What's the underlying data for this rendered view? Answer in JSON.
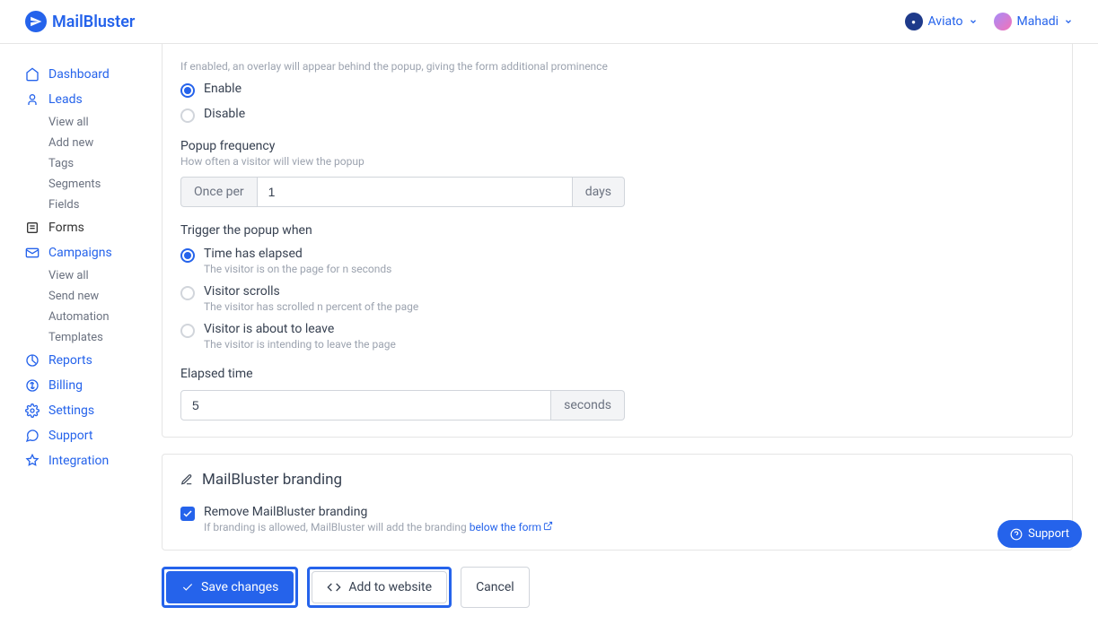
{
  "header": {
    "brand": "MailBluster",
    "workspace": "Aviato",
    "user": "Mahadi"
  },
  "sidebar": {
    "dashboard": "Dashboard",
    "leads": "Leads",
    "leads_items": [
      "View all",
      "Add new",
      "Tags",
      "Segments",
      "Fields"
    ],
    "forms": "Forms",
    "campaigns": "Campaigns",
    "campaigns_items": [
      "View all",
      "Send new",
      "Automation",
      "Templates"
    ],
    "reports": "Reports",
    "billing": "Billing",
    "settings": "Settings",
    "support": "Support",
    "integration": "Integration"
  },
  "overlay": {
    "desc": "If enabled, an overlay will appear behind the popup, giving the form additional prominence",
    "enable": "Enable",
    "disable": "Disable"
  },
  "frequency": {
    "label": "Popup frequency",
    "desc": "How often a visitor will view the popup",
    "prefix": "Once per",
    "value": "1",
    "suffix": "days"
  },
  "trigger": {
    "label": "Trigger the popup when",
    "opt1": "Time has elapsed",
    "opt1_desc": "The visitor is on the page for n seconds",
    "opt2": "Visitor scrolls",
    "opt2_desc": "The visitor has scrolled n percent of the page",
    "opt3": "Visitor is about to leave",
    "opt3_desc": "The visitor is intending to leave the page"
  },
  "elapsed": {
    "label": "Elapsed time",
    "value": "5",
    "suffix": "seconds"
  },
  "branding": {
    "title": "MailBluster branding",
    "checkbox_label": "Remove MailBluster branding",
    "desc_prefix": "If branding is allowed, MailBluster will add the branding ",
    "link": "below the form"
  },
  "buttons": {
    "save": "Save changes",
    "add": "Add to website",
    "cancel": "Cancel"
  },
  "support_float": "Support"
}
